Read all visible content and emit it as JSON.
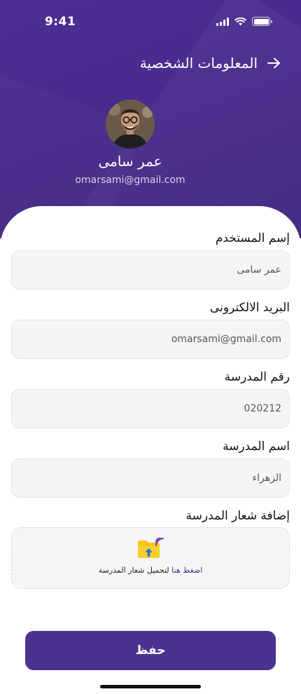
{
  "status_bar": {
    "time": "9:41"
  },
  "header": {
    "title": "المعلومات الشخصية"
  },
  "profile": {
    "name": "عمر سامى",
    "email": "omarsami@gmail.com"
  },
  "form": {
    "username": {
      "label": "إسم المستخدم",
      "value": "عمر سامى"
    },
    "email": {
      "label": "البريد الالكترونى",
      "value": "omarsami@gmail.com"
    },
    "school_number": {
      "label": "رقم المدرسة",
      "value": "020212"
    },
    "school_name": {
      "label": "اسم المدرسة",
      "value": "الزهراء"
    },
    "school_logo": {
      "label": "إضافة شعار المدرسة",
      "link_text": "اضغط هنا",
      "rest_text": " لتحميل شعار المدرسة"
    }
  },
  "actions": {
    "save_label": "حفظ"
  },
  "colors": {
    "primary": "#4c3290",
    "header_bg": "#482b8c",
    "folder": "#f5c518",
    "upload_arrow": "#2f6fd6"
  }
}
